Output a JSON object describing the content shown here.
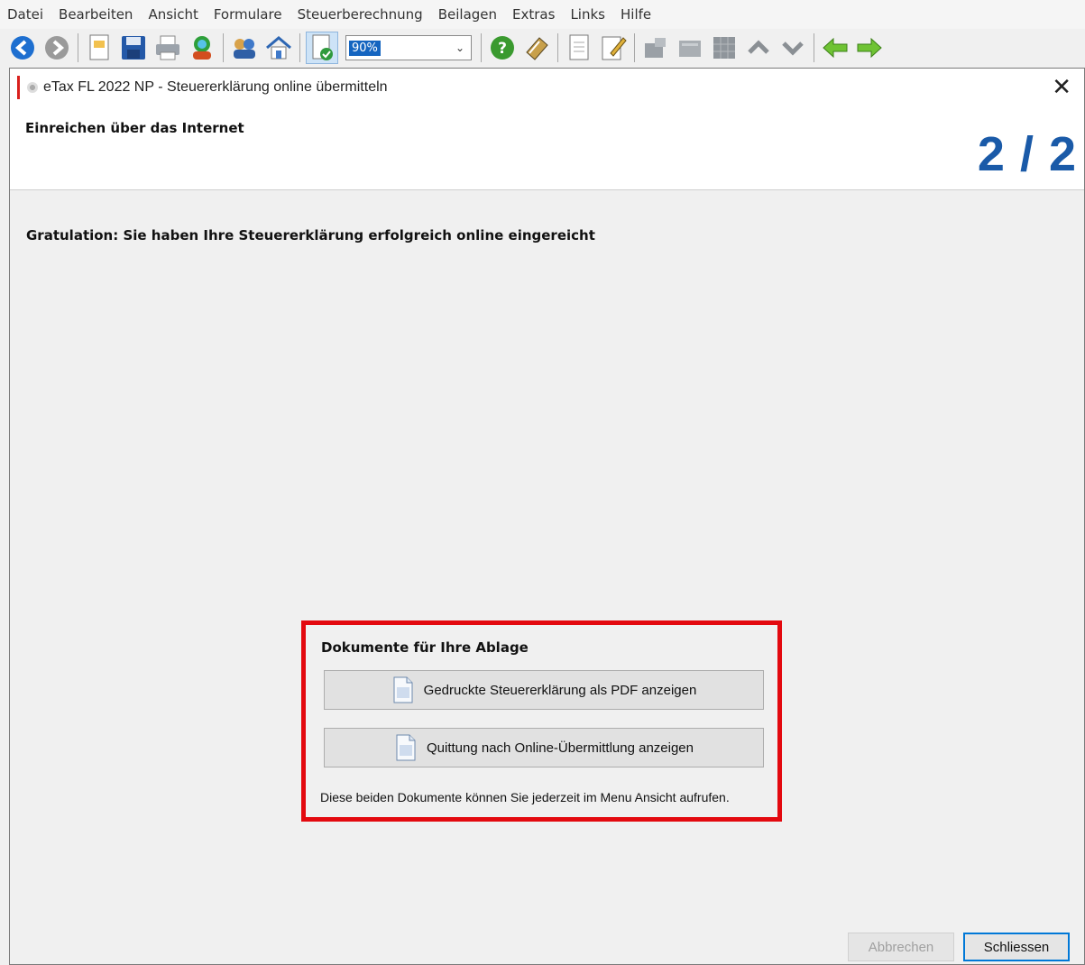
{
  "menu": [
    "Datei",
    "Bearbeiten",
    "Ansicht",
    "Formulare",
    "Steuerberechnung",
    "Beilagen",
    "Extras",
    "Links",
    "Hilfe"
  ],
  "toolbar": {
    "zoom_value": "90%",
    "icons": [
      "back-icon",
      "forward-icon",
      "new-document-icon",
      "save-icon",
      "print-icon",
      "web-icon",
      "persons-icon",
      "home-icon",
      "check-document-icon",
      "help-icon",
      "book-icon",
      "page-icon",
      "edit-icon",
      "sheet-icon",
      "table-icon",
      "grid-icon",
      "up-icon",
      "down-icon",
      "arrow-left-icon",
      "arrow-right-icon"
    ]
  },
  "dialog": {
    "title": "eTax FL 2022 NP - Steuererklärung online übermitteln",
    "header_title": "Einreichen über das Internet",
    "step": "2 / 2",
    "success_message": "Gratulation: Sie haben Ihre Steuererklärung erfolgreich online eingereicht",
    "documents": {
      "title": "Dokumente für Ihre Ablage",
      "pdf_button": "Gedruckte Steuererklärung als PDF anzeigen",
      "receipt_button": "Quittung nach Online-Übermittlung anzeigen",
      "note": "Diese beiden Dokumente können Sie jederzeit im Menu Ansicht aufrufen."
    },
    "cancel_button": "Abbrechen",
    "close_button": "Schliessen"
  },
  "colors": {
    "step_number": "#1a5aa8",
    "highlight_box": "#e3090f",
    "focus_border": "#0078d7"
  }
}
